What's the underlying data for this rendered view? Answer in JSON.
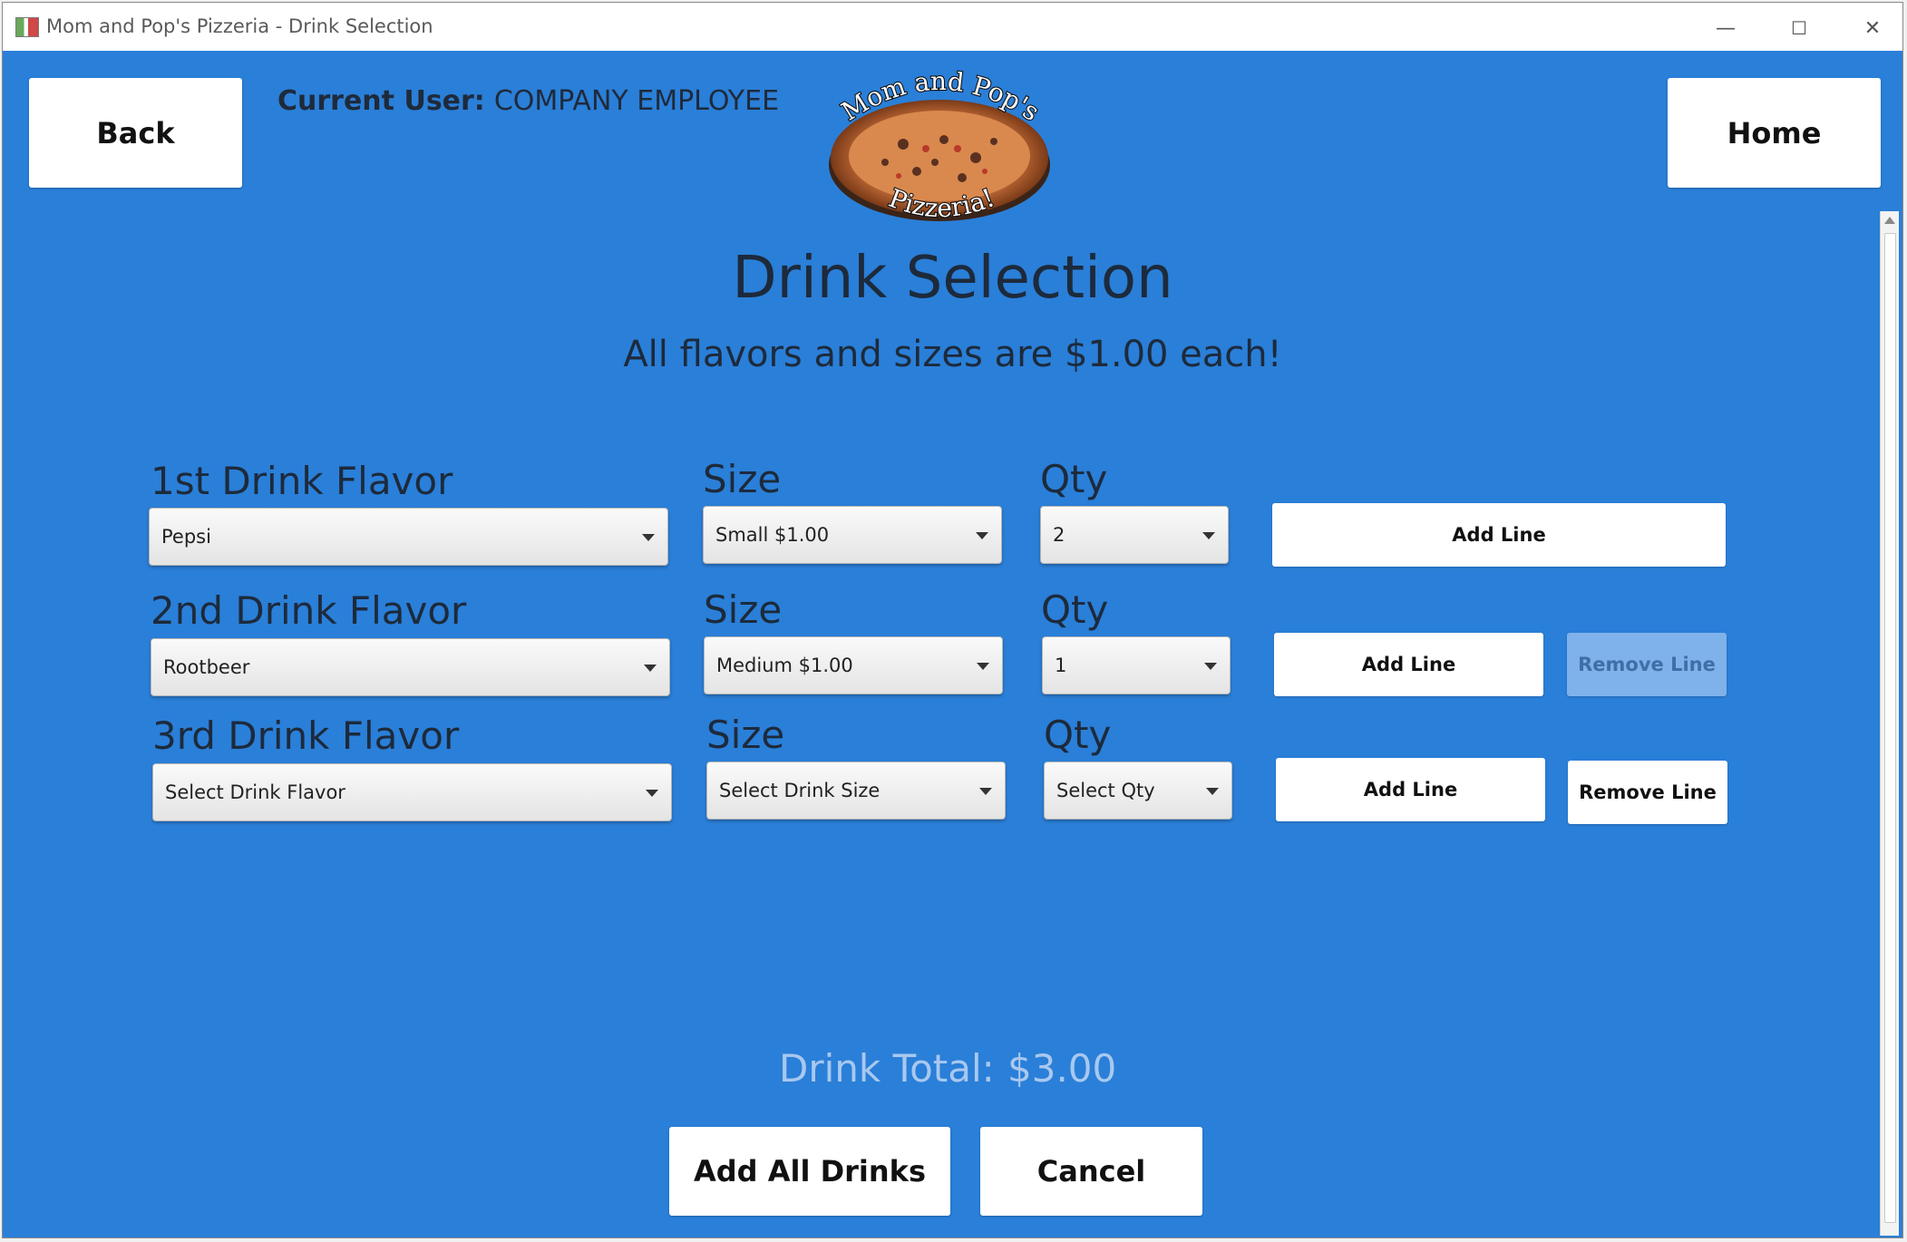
{
  "window": {
    "title": "Mom and Pop's Pizzeria - Drink Selection",
    "controls": {
      "minimize": "—",
      "maximize": "☐",
      "close": "✕"
    }
  },
  "header": {
    "back_label": "Back",
    "home_label": "Home",
    "current_user_label": "Current User:",
    "current_user_value": "COMPANY EMPLOYEE",
    "logo_top_text": "Mom and Pop's",
    "logo_bottom_text": "Pizzeria!"
  },
  "page": {
    "title": "Drink Selection",
    "subtitle": "All flavors and sizes are $1.00 each!"
  },
  "rows": [
    {
      "flavor_label": "1st Drink Flavor",
      "flavor_value": "Pepsi",
      "size_label": "Size",
      "size_value": "Small $1.00",
      "qty_label": "Qty",
      "qty_value": "2",
      "add_label": "Add Line"
    },
    {
      "flavor_label": "2nd Drink Flavor",
      "flavor_value": "Rootbeer",
      "size_label": "Size",
      "size_value": "Medium $1.00",
      "qty_label": "Qty",
      "qty_value": "1",
      "add_label": "Add Line",
      "remove_label": "Remove Line"
    },
    {
      "flavor_label": "3rd Drink Flavor",
      "flavor_value": "Select Drink Flavor",
      "size_label": "Size",
      "size_value": "Select Drink Size",
      "qty_label": "Qty",
      "qty_value": "Select Qty",
      "add_label": "Add Line",
      "remove_label": "Remove Line"
    }
  ],
  "footer": {
    "total_label": "Drink Total:",
    "total_value": "$3.00",
    "add_all_label": "Add All Drinks",
    "cancel_label": "Cancel"
  },
  "colors": {
    "background": "#2a7fd8",
    "button": "#ffffff",
    "disabled_button": "#7fb2ea"
  }
}
